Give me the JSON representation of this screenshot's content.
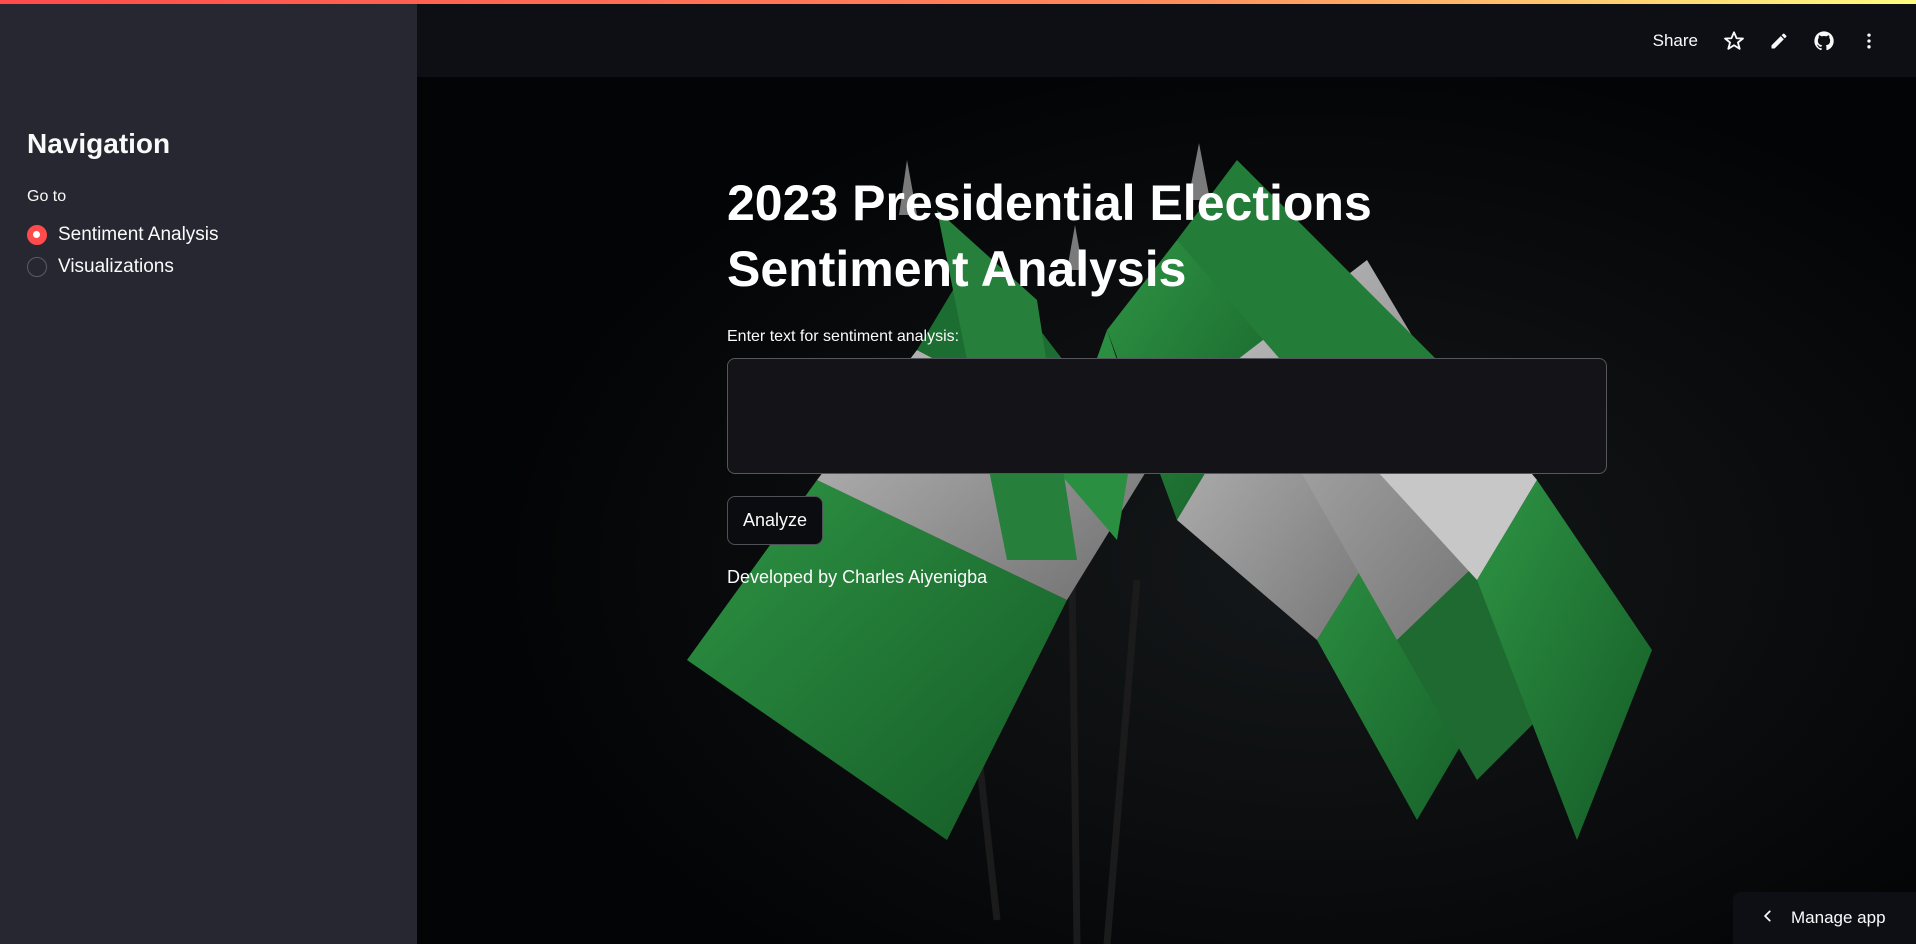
{
  "sidebar": {
    "title": "Navigation",
    "goto_label": "Go to",
    "options": [
      {
        "label": "Sentiment Analysis",
        "selected": true
      },
      {
        "label": "Visualizations",
        "selected": false
      }
    ]
  },
  "header": {
    "share_label": "Share",
    "icons": [
      "star-icon",
      "pencil-icon",
      "github-icon",
      "more-vert-icon"
    ]
  },
  "main": {
    "title_line1": "2023 Presidential Elections",
    "title_line2": "Sentiment Analysis",
    "input_label": "Enter text for sentiment analysis:",
    "input_value": "",
    "button_label": "Analyze",
    "credit": "Developed by Charles Aiyenigba"
  },
  "footer": {
    "manage_label": "Manage app"
  },
  "colors": {
    "accent": "#ff4b4b",
    "sidebar_bg": "#262730",
    "header_bg": "#0d0f15",
    "flag_green": "#1f7a34",
    "flag_white": "#d9d9d9"
  }
}
